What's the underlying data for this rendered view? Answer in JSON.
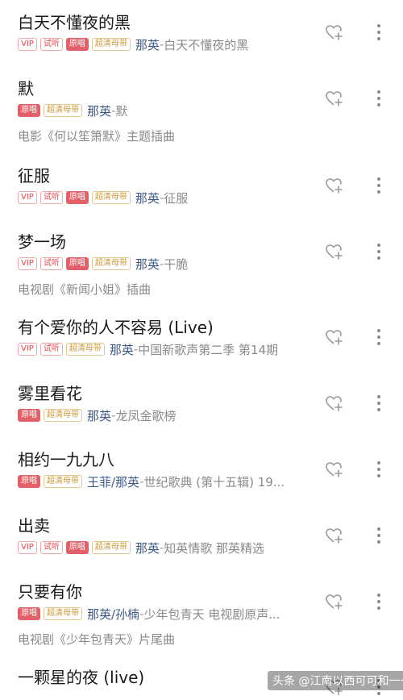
{
  "songs": [
    {
      "title": "白天不懂夜的黑",
      "tags": [
        "VIP",
        "试听",
        "原唱",
        "超清母带"
      ],
      "artists": "那英",
      "detail": "白天不懂夜的黑",
      "sub": ""
    },
    {
      "title": "默",
      "tags": [
        "原唱",
        "超清母带"
      ],
      "artists": "那英",
      "detail": "默",
      "sub": "电影《何以笙箫默》主题插曲"
    },
    {
      "title": "征服",
      "tags": [
        "VIP",
        "试听",
        "原唱",
        "超清母带"
      ],
      "artists": "那英",
      "detail": "征服",
      "sub": ""
    },
    {
      "title": "梦一场",
      "tags": [
        "VIP",
        "试听",
        "原唱",
        "超清母带"
      ],
      "artists": "那英",
      "detail": "干脆",
      "sub": "电视剧《新闻小姐》插曲"
    },
    {
      "title": "有个爱你的人不容易 (Live)",
      "tags": [
        "VIP",
        "试听",
        "超清母带"
      ],
      "artists": "那英",
      "detail": "中国新歌声第二季 第14期",
      "sub": ""
    },
    {
      "title": "雾里看花",
      "tags": [
        "原唱",
        "超清母带"
      ],
      "artists": "那英",
      "detail": "龙凤金歌榜",
      "sub": ""
    },
    {
      "title": "相约一九九八",
      "tags": [
        "原唱",
        "超清母带"
      ],
      "artists": "王菲/那英",
      "detail": "世纪歌典 (第十五辑) 19...",
      "sub": ""
    },
    {
      "title": "出卖",
      "tags": [
        "VIP",
        "试听",
        "原唱",
        "超清母带"
      ],
      "artists": "那英",
      "detail": "知英情歌 那英精选",
      "sub": ""
    },
    {
      "title": "只要有你",
      "tags": [
        "原唱",
        "超清母带"
      ],
      "artists": "那英/孙楠",
      "detail": "少年包青天 电视剧原声...",
      "sub": "电视剧《少年包青天》片尾曲"
    },
    {
      "title": "一颗星的夜 (live)",
      "tags": [],
      "artists": "",
      "detail": "",
      "sub": ""
    }
  ],
  "separator": " - ",
  "watermark": "头条 @江南以西可可和一一",
  "icons": {
    "like": "heart-plus-icon",
    "more": "more-vertical-icon"
  },
  "colors": {
    "accent_tag": "#e5484d",
    "orig_bg": "#e26168",
    "hq": "#c99a3c",
    "artist": "#3d5a87"
  }
}
